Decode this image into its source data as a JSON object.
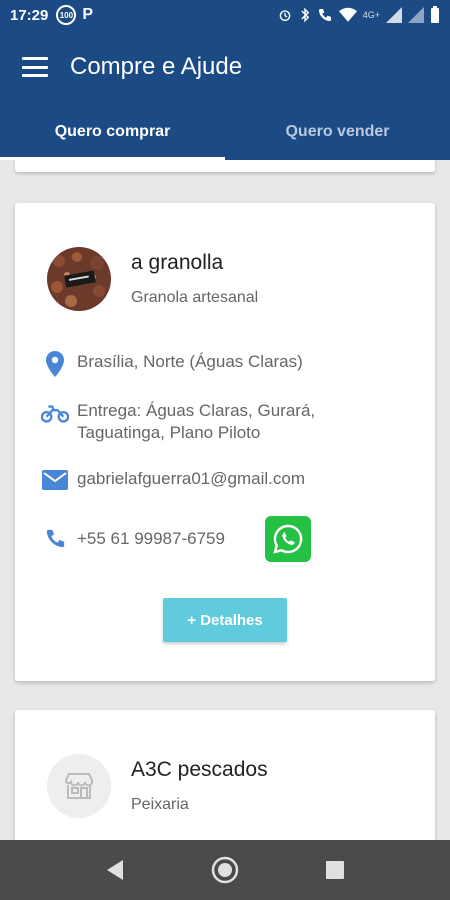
{
  "statusbar": {
    "time": "17:29",
    "badge": "100",
    "p_label": "P",
    "network": "4G+"
  },
  "appbar": {
    "title": "Compre e Ajude"
  },
  "tabs": [
    {
      "label": "Quero comprar",
      "active": true
    },
    {
      "label": "Quero vender",
      "active": false
    }
  ],
  "cards": [
    {
      "name": "a granolla",
      "category": "Granola artesanal",
      "location": "Brasília, Norte (Águas Claras)",
      "delivery_line1": "Entrega: Águas Claras, Gurará,",
      "delivery_line2": "Taguatinga, Plano Piloto",
      "email": "gabrielafguerra01@gmail.com",
      "phone": "+55 61 99987-6759",
      "details_button": "+ Detalhes"
    },
    {
      "name": "A3C pescados",
      "category": "Peixaria"
    }
  ],
  "colors": {
    "primary": "#1b4a85",
    "accent": "#5fcbdc",
    "icon_blue": "#4a86d8",
    "whatsapp": "#25c145"
  },
  "icons": [
    "menu-icon",
    "location-pin-icon",
    "motorcycle-icon",
    "email-icon",
    "phone-icon",
    "whatsapp-icon",
    "store-icon",
    "back-icon",
    "home-icon",
    "recents-icon"
  ]
}
